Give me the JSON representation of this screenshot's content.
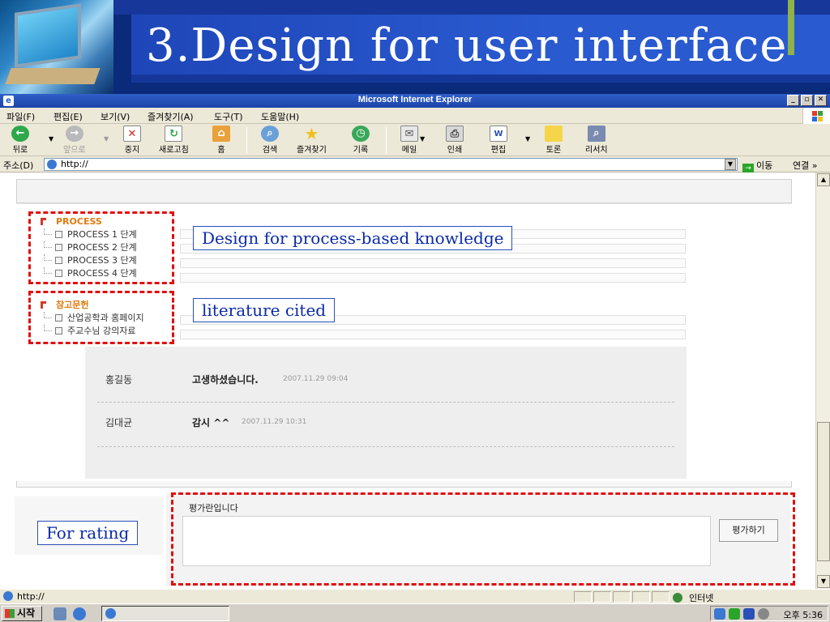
{
  "slide": {
    "title": "3.Design for user interface"
  },
  "window": {
    "title": "Microsoft Internet Explorer",
    "min": "_",
    "max": "▫",
    "close": "✕"
  },
  "menu": [
    "파일(F)",
    "편집(E)",
    "보기(V)",
    "즐겨찾기(A)",
    "도구(T)",
    "도움말(H)"
  ],
  "toolbar": {
    "back": "뒤로",
    "forward": "앞으로",
    "stop": "중지",
    "refresh": "새로고침",
    "home": "홈",
    "search": "검색",
    "favorites": "즐겨찾기",
    "history": "기록",
    "mail": "메일",
    "print": "인쇄",
    "edit": "편집",
    "discuss": "토론",
    "research": "리서치"
  },
  "address": {
    "label": "주소(D)",
    "value": "http://",
    "go": "이동",
    "links": "연결 »"
  },
  "tree1": {
    "head": "PROCESS",
    "items": [
      "PROCESS 1 단계",
      "PROCESS 2 단계",
      "PROCESS 3 단계",
      "PROCESS 4 단계"
    ]
  },
  "tree2": {
    "head": "참고문헌",
    "items": [
      "산업공학과 홈페이지",
      "주교수님 강의자료"
    ]
  },
  "callouts": {
    "process": "Design for process-based knowledge",
    "literature": "literature cited",
    "rating": "For rating"
  },
  "comments": [
    {
      "author": "홍길동",
      "message": "고생하셨습니다.",
      "time": "2007.11.29 09:04"
    },
    {
      "author": "김대균",
      "message": "감시 ^^",
      "time": "2007.11.29 10:31"
    }
  ],
  "rating": {
    "label": "평가란입니다",
    "button": "평가하기",
    "value": ""
  },
  "status": {
    "text": "http://",
    "zone": "인터넷"
  },
  "taskbar": {
    "start": "시작",
    "clock": "오후 5:36"
  },
  "colors": {
    "accent_red": "#e01010",
    "callout_blue": "#0a2aa8",
    "banner_blue": "#1e46b8",
    "tree_orange": "#e07a10"
  },
  "icons": [
    "back-icon",
    "forward-icon",
    "stop-icon",
    "refresh-icon",
    "home-icon",
    "search-icon",
    "favorites-icon",
    "history-icon",
    "mail-icon",
    "print-icon",
    "edit-icon",
    "discuss-icon",
    "research-icon"
  ]
}
